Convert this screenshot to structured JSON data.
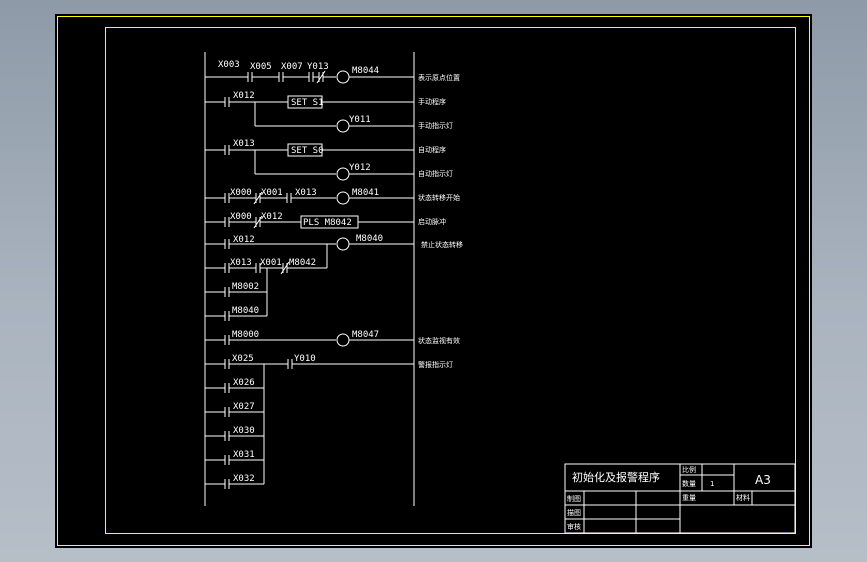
{
  "colors": {
    "background": "#000000",
    "border": "#ffff00",
    "lines": "#ffffff"
  },
  "rungs": [
    {
      "contacts": [
        "X003",
        "X005",
        "X007",
        "Y013"
      ],
      "output": "M8044",
      "comment": "表示原点位置"
    },
    {
      "contacts": [
        "X012"
      ],
      "output": "SET S1",
      "comment": "手动程序"
    },
    {
      "output": "Y011",
      "comment": "手动指示灯"
    },
    {
      "contacts": [
        "X013"
      ],
      "output": "SET S0",
      "comment": "自动程序"
    },
    {
      "output": "Y012",
      "comment": "自动指示灯"
    },
    {
      "contacts": [
        "X000",
        "X001",
        "X013"
      ],
      "output": "M8041",
      "comment": "状态转移开始"
    },
    {
      "contacts": [
        "X000",
        "X012"
      ],
      "output": "PLS M8042",
      "comment": "启动脉冲"
    },
    {
      "contacts": [
        "X012"
      ],
      "output": "M8040",
      "comment": "禁止状态转移"
    },
    {
      "contacts": [
        "X013",
        "X001",
        "M8042"
      ]
    },
    {
      "contacts": [
        "M8002"
      ]
    },
    {
      "contacts": [
        "M8040"
      ]
    },
    {
      "contacts": [
        "M8000"
      ],
      "output": "M8047",
      "comment": "状态监视有效"
    },
    {
      "contacts": [
        "X025",
        "Y010"
      ],
      "comment": "警报指示灯"
    },
    {
      "contacts": [
        "X026"
      ]
    },
    {
      "contacts": [
        "X027"
      ]
    },
    {
      "contacts": [
        "X030"
      ]
    },
    {
      "contacts": [
        "X031"
      ]
    },
    {
      "contacts": [
        "X032"
      ]
    }
  ],
  "title_block": {
    "title": "初始化及报警程序",
    "scale_label": "比例",
    "quantity_label": "数量",
    "quantity_value": "1",
    "weight_label": "重量",
    "material_label": "材料",
    "drawn_label": "制图",
    "description_label": "描图",
    "review_label": "审核",
    "sheet_size": "A3"
  }
}
